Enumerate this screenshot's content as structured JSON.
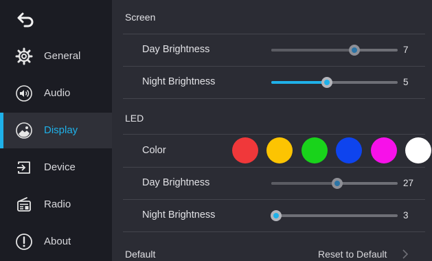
{
  "sidebar": {
    "items": [
      {
        "label": "General",
        "icon": "gear-icon"
      },
      {
        "label": "Audio",
        "icon": "speaker-icon"
      },
      {
        "label": "Display",
        "icon": "display-icon",
        "active": true
      },
      {
        "label": "Device",
        "icon": "device-input-icon"
      },
      {
        "label": "Radio",
        "icon": "radio-icon"
      },
      {
        "label": "About",
        "icon": "info-exclamation-icon"
      }
    ]
  },
  "screen": {
    "title": "Screen",
    "day_brightness": {
      "label": "Day Brightness",
      "value": "7",
      "level": 0.66
    },
    "night_brightness": {
      "label": "Night Brightness",
      "value": "5",
      "level": 0.44
    }
  },
  "led": {
    "title": "LED",
    "color_label": "Color",
    "colors": [
      "#f0383a",
      "#fcc402",
      "#19d31b",
      "#0e44ee",
      "#f711e9",
      "#ffffff"
    ],
    "day_brightness": {
      "label": "Day Brightness",
      "value": "27",
      "level": 0.52
    },
    "night_brightness": {
      "label": "Night Brightness",
      "value": "3",
      "level": 0.04
    }
  },
  "footer": {
    "default_label": "Default",
    "reset_label": "Reset to Default"
  },
  "theme": {
    "accent": "#1fb1e9",
    "sidebar_bg": "#1b1c23",
    "panel_bg": "#2b2c34"
  }
}
